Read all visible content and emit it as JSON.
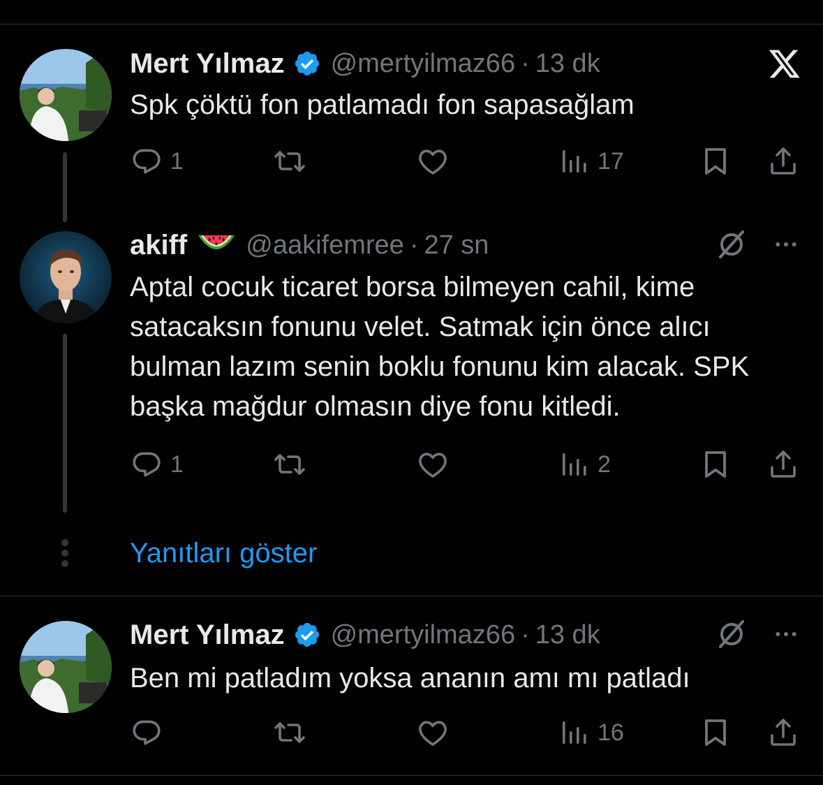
{
  "tweets": [
    {
      "name": "Mert Yılmaz",
      "verified": true,
      "handle": "@mertyilmaz66",
      "separator": "·",
      "time": "13 dk",
      "text": "Spk çöktü fon patlamadı fon sapasağlam",
      "counts": {
        "reply": "1",
        "retweet": "",
        "like": "",
        "views": "17"
      }
    },
    {
      "name": "akiff",
      "emoji": "watermelon-emoji",
      "handle": "@aakifemree",
      "separator": "·",
      "time": "27 sn",
      "text": "Aptal cocuk ticaret borsa bilmeyen cahil, kime satacaksın fonunu velet. Satmak için önce alıcı bulman lazım senin boklu fonunu kim alacak. SPK başka mağdur olmasın diye fonu kitledi.",
      "counts": {
        "reply": "1",
        "retweet": "",
        "like": "",
        "views": "2"
      }
    },
    {
      "name": "Mert Yılmaz",
      "verified": true,
      "handle": "@mertyilmaz66",
      "separator": "·",
      "time": "13 dk",
      "text": "Ben mi patladım yoksa ananın amı mı patladı",
      "counts": {
        "reply": "",
        "retweet": "",
        "like": "",
        "views": "16"
      }
    }
  ],
  "show_replies_label": "Yanıtları göster",
  "icons": [
    "x-logo-icon",
    "grok-icon",
    "more-icon",
    "reply-icon",
    "retweet-icon",
    "like-icon",
    "views-icon",
    "bookmark-icon",
    "share-icon",
    "verified-badge-icon"
  ],
  "colors": {
    "background": "#000000",
    "text": "#e7e9ea",
    "muted": "#71767b",
    "accent": "#1d9bf0"
  }
}
